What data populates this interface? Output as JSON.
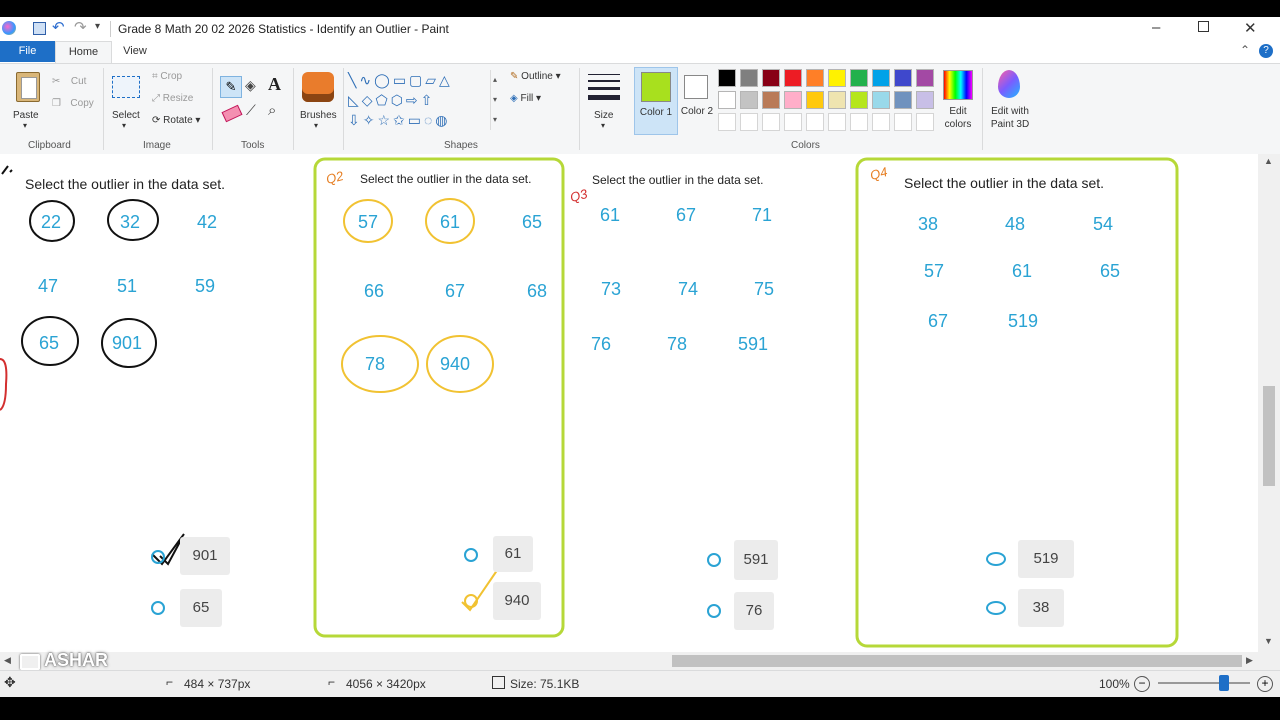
{
  "window": {
    "title": "Grade 8 Math 20 02 2026 Statistics - Identify an Outlier - Paint"
  },
  "tabs": [
    {
      "label": "File"
    },
    {
      "label": "Home"
    },
    {
      "label": "View"
    }
  ],
  "clipboard": {
    "paste": "Paste",
    "cut": "Cut",
    "copy": "Copy",
    "group": "Clipboard"
  },
  "image": {
    "select": "Select",
    "crop": "Crop",
    "resize": "Resize",
    "rotate": "Rotate",
    "group": "Image"
  },
  "tools": {
    "group": "Tools"
  },
  "brushes": {
    "label": "Brushes"
  },
  "shapes": {
    "outline": "Outline",
    "fill": "Fill",
    "group": "Shapes"
  },
  "size": {
    "label": "Size"
  },
  "colors": {
    "color1": "Color 1",
    "color2": "Color 2",
    "edit_colors": "Edit colors",
    "edit_3d": "Edit with Paint 3D",
    "group": "Colors",
    "color1_value": "#a8e01e",
    "color2_value": "#ffffff",
    "row1": [
      "#000000",
      "#7f7f7f",
      "#880015",
      "#ed1c24",
      "#ff7f27",
      "#fff200",
      "#22b14c",
      "#00a2e8",
      "#3f48cc",
      "#a349a4"
    ],
    "row2": [
      "#ffffff",
      "#c3c3c3",
      "#b97a57",
      "#ffaec9",
      "#ffc90e",
      "#efe4b0",
      "#b5e61d",
      "#99d9ea",
      "#7092be",
      "#c8bfe7"
    ]
  },
  "canvas": {
    "q1": {
      "prompt": "Select the outlier in the data set.",
      "numbers": [
        "22",
        "32",
        "42",
        "47",
        "51",
        "59",
        "65",
        "901"
      ],
      "answers": [
        "901",
        "65"
      ]
    },
    "q2": {
      "prompt": "Select the outlier in the data set.",
      "label": "Q2",
      "numbers": [
        "57",
        "61",
        "65",
        "66",
        "67",
        "68",
        "78",
        "940"
      ],
      "answers": [
        "61",
        "940"
      ]
    },
    "q3": {
      "prompt": "Select the outlier in the data set.",
      "label": "Q3",
      "numbers": [
        "61",
        "67",
        "71",
        "73",
        "74",
        "75",
        "76",
        "78",
        "591"
      ],
      "answers": [
        "591",
        "76"
      ]
    },
    "q4": {
      "prompt": "Select the outlier in the data set.",
      "label": "Q4",
      "numbers": [
        "38",
        "48",
        "54",
        "57",
        "61",
        "65",
        "67",
        "519"
      ],
      "answers": [
        "519",
        "38"
      ]
    },
    "watermark": "ASHAR"
  },
  "status": {
    "cursor": "484 × 737px",
    "dimensions": "4056 × 3420px",
    "size": "Size: 75.1KB",
    "zoom": "100%",
    "zoom_fraction": 0.72
  }
}
